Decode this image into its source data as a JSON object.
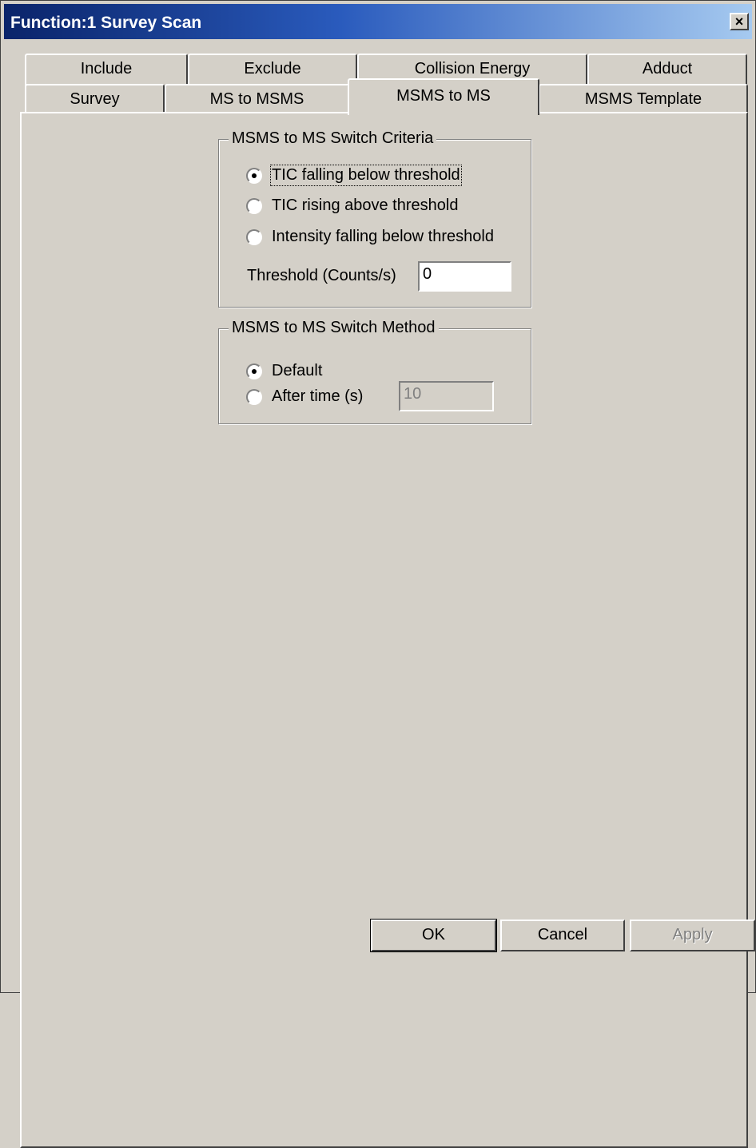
{
  "window": {
    "title": "Function:1 Survey Scan",
    "close_label": "×",
    "close_icon": "close-icon"
  },
  "tabs": {
    "row1": [
      "Include",
      "Exclude",
      "Collision Energy",
      "Adduct"
    ],
    "row2": [
      "Survey",
      "MS to MSMS",
      "MSMS to MS",
      "MSMS Template"
    ],
    "active": "MSMS to MS"
  },
  "criteria": {
    "label": "MSMS to MS Switch Criteria",
    "options": [
      {
        "label": "TIC falling below threshold",
        "checked": true
      },
      {
        "label": "TIC rising above threshold",
        "checked": false
      },
      {
        "label": "Intensity falling below threshold",
        "checked": false
      }
    ],
    "threshold_label": "Threshold (Counts/s)",
    "threshold_value": "0"
  },
  "method": {
    "label": "MSMS to MS Switch Method",
    "options": [
      {
        "label": "Default",
        "checked": true
      },
      {
        "label": "After time (s)",
        "checked": false
      }
    ],
    "after_time_value": "10"
  },
  "buttons": {
    "ok": "OK",
    "cancel": "Cancel",
    "apply": "Apply"
  }
}
